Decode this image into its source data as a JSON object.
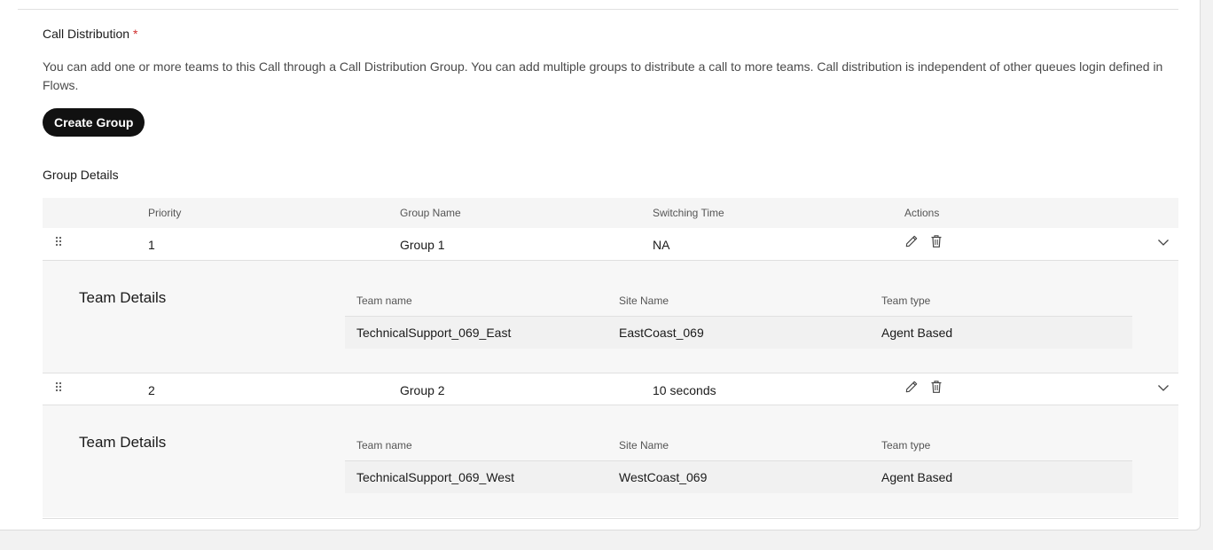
{
  "section": {
    "title": "Call Distribution",
    "required_mark": "*",
    "description": "You can add one or more teams to this Call through a Call Distribution Group. You can add multiple groups to distribute a call to more teams. Call distribution is independent of other queues login defined in Flows.",
    "create_button": "Create Group",
    "group_details_title": "Group Details"
  },
  "table": {
    "headers": {
      "priority": "Priority",
      "group_name": "Group Name",
      "switching_time": "Switching Time",
      "actions": "Actions"
    },
    "groups": [
      {
        "priority": "1",
        "name": "Group 1",
        "switching_time": "NA",
        "team_details_title": "Team Details",
        "team_headers": {
          "team_name": "Team name",
          "site_name": "Site Name",
          "team_type": "Team type"
        },
        "teams": [
          {
            "team_name": "TechnicalSupport_069_East",
            "site_name": "EastCoast_069",
            "team_type": "Agent Based"
          }
        ]
      },
      {
        "priority": "2",
        "name": "Group 2",
        "switching_time": "10 seconds",
        "team_details_title": "Team Details",
        "team_headers": {
          "team_name": "Team name",
          "site_name": "Site Name",
          "team_type": "Team type"
        },
        "teams": [
          {
            "team_name": "TechnicalSupport_069_West",
            "site_name": "WestCoast_069",
            "team_type": "Agent Based"
          }
        ]
      }
    ]
  },
  "icons": {
    "drag": "drag-handle-icon",
    "edit": "pencil-icon",
    "delete": "trash-icon",
    "expand": "chevron-down-icon"
  },
  "colors": {
    "required": "#d0302f",
    "button_bg": "#111111",
    "button_text": "#ffffff"
  }
}
